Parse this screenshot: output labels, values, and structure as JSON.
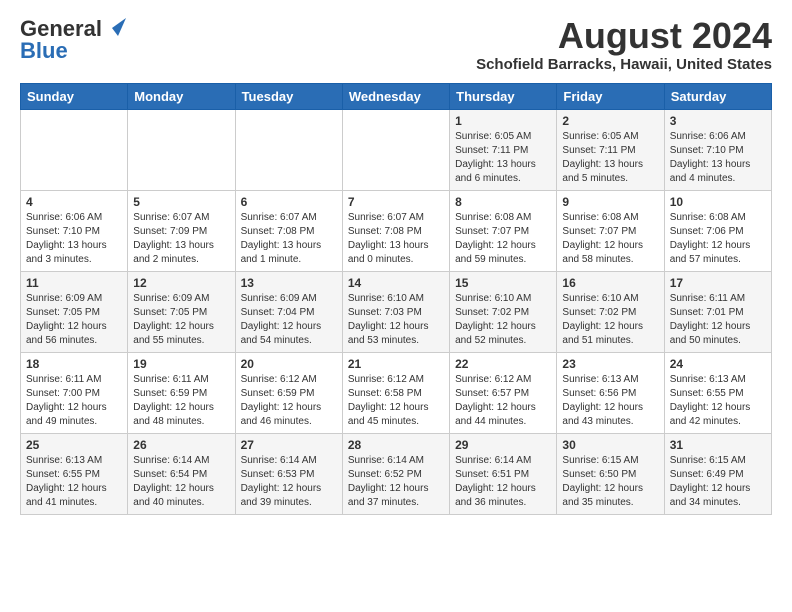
{
  "header": {
    "logo_general": "General",
    "logo_blue": "Blue",
    "month_title": "August 2024",
    "location": "Schofield Barracks, Hawaii, United States"
  },
  "weekdays": [
    "Sunday",
    "Monday",
    "Tuesday",
    "Wednesday",
    "Thursday",
    "Friday",
    "Saturday"
  ],
  "weeks": [
    [
      {
        "day": "",
        "sunrise": "",
        "sunset": "",
        "daylight": ""
      },
      {
        "day": "",
        "sunrise": "",
        "sunset": "",
        "daylight": ""
      },
      {
        "day": "",
        "sunrise": "",
        "sunset": "",
        "daylight": ""
      },
      {
        "day": "",
        "sunrise": "",
        "sunset": "",
        "daylight": ""
      },
      {
        "day": "1",
        "sunrise": "Sunrise: 6:05 AM",
        "sunset": "Sunset: 7:11 PM",
        "daylight": "Daylight: 13 hours and 6 minutes."
      },
      {
        "day": "2",
        "sunrise": "Sunrise: 6:05 AM",
        "sunset": "Sunset: 7:11 PM",
        "daylight": "Daylight: 13 hours and 5 minutes."
      },
      {
        "day": "3",
        "sunrise": "Sunrise: 6:06 AM",
        "sunset": "Sunset: 7:10 PM",
        "daylight": "Daylight: 13 hours and 4 minutes."
      }
    ],
    [
      {
        "day": "4",
        "sunrise": "Sunrise: 6:06 AM",
        "sunset": "Sunset: 7:10 PM",
        "daylight": "Daylight: 13 hours and 3 minutes."
      },
      {
        "day": "5",
        "sunrise": "Sunrise: 6:07 AM",
        "sunset": "Sunset: 7:09 PM",
        "daylight": "Daylight: 13 hours and 2 minutes."
      },
      {
        "day": "6",
        "sunrise": "Sunrise: 6:07 AM",
        "sunset": "Sunset: 7:08 PM",
        "daylight": "Daylight: 13 hours and 1 minute."
      },
      {
        "day": "7",
        "sunrise": "Sunrise: 6:07 AM",
        "sunset": "Sunset: 7:08 PM",
        "daylight": "Daylight: 13 hours and 0 minutes."
      },
      {
        "day": "8",
        "sunrise": "Sunrise: 6:08 AM",
        "sunset": "Sunset: 7:07 PM",
        "daylight": "Daylight: 12 hours and 59 minutes."
      },
      {
        "day": "9",
        "sunrise": "Sunrise: 6:08 AM",
        "sunset": "Sunset: 7:07 PM",
        "daylight": "Daylight: 12 hours and 58 minutes."
      },
      {
        "day": "10",
        "sunrise": "Sunrise: 6:08 AM",
        "sunset": "Sunset: 7:06 PM",
        "daylight": "Daylight: 12 hours and 57 minutes."
      }
    ],
    [
      {
        "day": "11",
        "sunrise": "Sunrise: 6:09 AM",
        "sunset": "Sunset: 7:05 PM",
        "daylight": "Daylight: 12 hours and 56 minutes."
      },
      {
        "day": "12",
        "sunrise": "Sunrise: 6:09 AM",
        "sunset": "Sunset: 7:05 PM",
        "daylight": "Daylight: 12 hours and 55 minutes."
      },
      {
        "day": "13",
        "sunrise": "Sunrise: 6:09 AM",
        "sunset": "Sunset: 7:04 PM",
        "daylight": "Daylight: 12 hours and 54 minutes."
      },
      {
        "day": "14",
        "sunrise": "Sunrise: 6:10 AM",
        "sunset": "Sunset: 7:03 PM",
        "daylight": "Daylight: 12 hours and 53 minutes."
      },
      {
        "day": "15",
        "sunrise": "Sunrise: 6:10 AM",
        "sunset": "Sunset: 7:02 PM",
        "daylight": "Daylight: 12 hours and 52 minutes."
      },
      {
        "day": "16",
        "sunrise": "Sunrise: 6:10 AM",
        "sunset": "Sunset: 7:02 PM",
        "daylight": "Daylight: 12 hours and 51 minutes."
      },
      {
        "day": "17",
        "sunrise": "Sunrise: 6:11 AM",
        "sunset": "Sunset: 7:01 PM",
        "daylight": "Daylight: 12 hours and 50 minutes."
      }
    ],
    [
      {
        "day": "18",
        "sunrise": "Sunrise: 6:11 AM",
        "sunset": "Sunset: 7:00 PM",
        "daylight": "Daylight: 12 hours and 49 minutes."
      },
      {
        "day": "19",
        "sunrise": "Sunrise: 6:11 AM",
        "sunset": "Sunset: 6:59 PM",
        "daylight": "Daylight: 12 hours and 48 minutes."
      },
      {
        "day": "20",
        "sunrise": "Sunrise: 6:12 AM",
        "sunset": "Sunset: 6:59 PM",
        "daylight": "Daylight: 12 hours and 46 minutes."
      },
      {
        "day": "21",
        "sunrise": "Sunrise: 6:12 AM",
        "sunset": "Sunset: 6:58 PM",
        "daylight": "Daylight: 12 hours and 45 minutes."
      },
      {
        "day": "22",
        "sunrise": "Sunrise: 6:12 AM",
        "sunset": "Sunset: 6:57 PM",
        "daylight": "Daylight: 12 hours and 44 minutes."
      },
      {
        "day": "23",
        "sunrise": "Sunrise: 6:13 AM",
        "sunset": "Sunset: 6:56 PM",
        "daylight": "Daylight: 12 hours and 43 minutes."
      },
      {
        "day": "24",
        "sunrise": "Sunrise: 6:13 AM",
        "sunset": "Sunset: 6:55 PM",
        "daylight": "Daylight: 12 hours and 42 minutes."
      }
    ],
    [
      {
        "day": "25",
        "sunrise": "Sunrise: 6:13 AM",
        "sunset": "Sunset: 6:55 PM",
        "daylight": "Daylight: 12 hours and 41 minutes."
      },
      {
        "day": "26",
        "sunrise": "Sunrise: 6:14 AM",
        "sunset": "Sunset: 6:54 PM",
        "daylight": "Daylight: 12 hours and 40 minutes."
      },
      {
        "day": "27",
        "sunrise": "Sunrise: 6:14 AM",
        "sunset": "Sunset: 6:53 PM",
        "daylight": "Daylight: 12 hours and 39 minutes."
      },
      {
        "day": "28",
        "sunrise": "Sunrise: 6:14 AM",
        "sunset": "Sunset: 6:52 PM",
        "daylight": "Daylight: 12 hours and 37 minutes."
      },
      {
        "day": "29",
        "sunrise": "Sunrise: 6:14 AM",
        "sunset": "Sunset: 6:51 PM",
        "daylight": "Daylight: 12 hours and 36 minutes."
      },
      {
        "day": "30",
        "sunrise": "Sunrise: 6:15 AM",
        "sunset": "Sunset: 6:50 PM",
        "daylight": "Daylight: 12 hours and 35 minutes."
      },
      {
        "day": "31",
        "sunrise": "Sunrise: 6:15 AM",
        "sunset": "Sunset: 6:49 PM",
        "daylight": "Daylight: 12 hours and 34 minutes."
      }
    ]
  ]
}
